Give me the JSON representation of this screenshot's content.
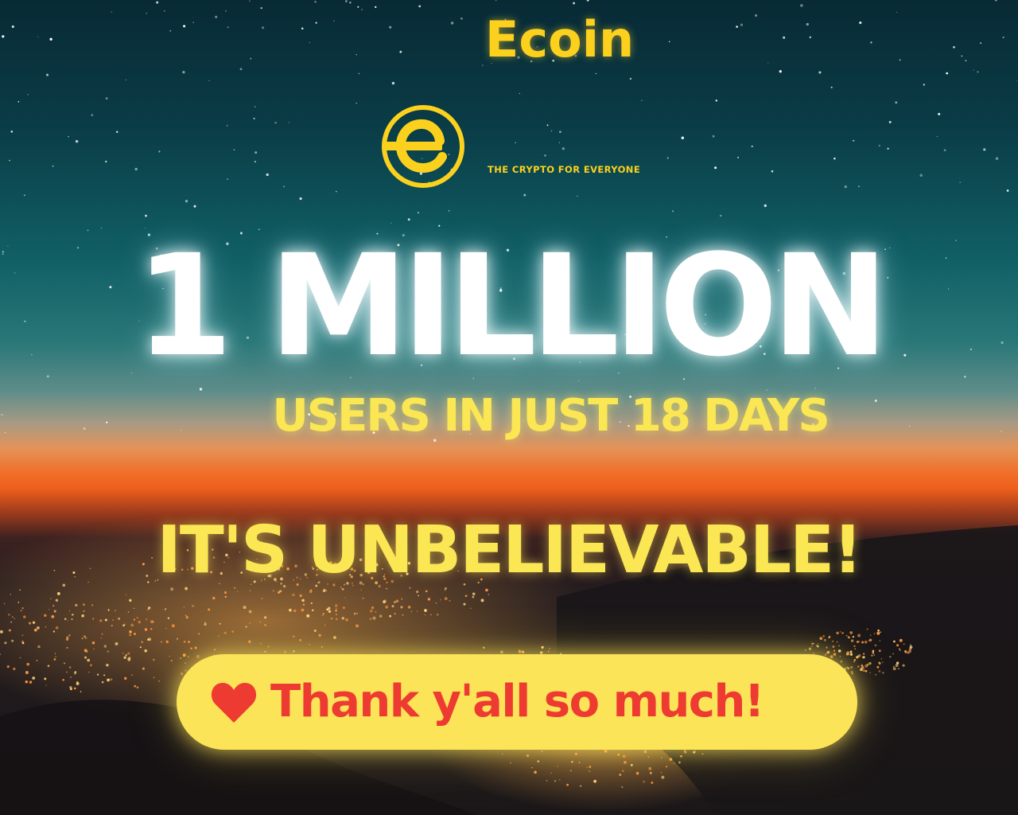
{
  "brand": {
    "name": "Ecoin",
    "tagline": "THE CRYPTO FOR EVERYONE",
    "logo_icon": "ecoin-logo-icon",
    "color": "#fbd11d"
  },
  "headline": "1 MILLION",
  "subheadline": "USERS IN JUST 18 DAYS",
  "exclamation": "IT'S UNBELIEVABLE!",
  "thanks": {
    "icon": "heart-icon",
    "text": "Thank y'all so much!",
    "text_color": "#ee3b32",
    "pill_color": "#fce459"
  },
  "colors": {
    "headline": "#ffffff",
    "accent_yellow": "#fbe653"
  }
}
